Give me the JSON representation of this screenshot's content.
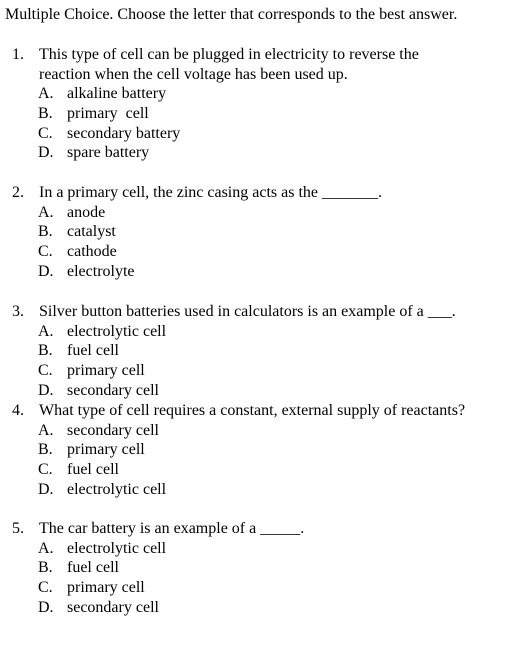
{
  "instructions": "Multiple Choice.  Choose the letter that corresponds to the best answer.",
  "questions": [
    {
      "number": "1.",
      "lines": [
        "This type of cell can be plugged in electricity to reverse the",
        "reaction when the cell voltage has been used up."
      ],
      "options": [
        {
          "letter": "A.",
          "text": "alkaline battery"
        },
        {
          "letter": "B.",
          "text": "primary  cell"
        },
        {
          "letter": "C.",
          "text": "secondary battery"
        },
        {
          "letter": "D.",
          "text": "spare battery"
        }
      ]
    },
    {
      "number": "2.",
      "lines": [
        "In a primary cell, the zinc casing acts as the _______."
      ],
      "options": [
        {
          "letter": "A.",
          "text": "anode"
        },
        {
          "letter": "B.",
          "text": "catalyst"
        },
        {
          "letter": "C.",
          "text": "cathode"
        },
        {
          "letter": "D.",
          "text": "electrolyte"
        }
      ]
    },
    {
      "number": "3.",
      "lines": [
        "Silver button batteries used in calculators is an example of a ___."
      ],
      "options": [
        {
          "letter": "A.",
          "text": "electrolytic cell"
        },
        {
          "letter": "B.",
          "text": "fuel cell"
        },
        {
          "letter": "C.",
          "text": "primary cell"
        },
        {
          "letter": "D.",
          "text": "secondary cell"
        }
      ]
    },
    {
      "number": "4.",
      "lines": [
        "What type of cell requires a constant, external supply of reactants?"
      ],
      "options": [
        {
          "letter": "A.",
          "text": "secondary cell"
        },
        {
          "letter": "B.",
          "text": "primary cell"
        },
        {
          "letter": "C.",
          "text": "fuel cell"
        },
        {
          "letter": "D.",
          "text": "electrolytic cell"
        }
      ]
    },
    {
      "number": "5.",
      "lines": [
        "The car battery is an example of a _____."
      ],
      "options": [
        {
          "letter": "A.",
          "text": "electrolytic cell"
        },
        {
          "letter": "B.",
          "text": "fuel cell"
        },
        {
          "letter": "C.",
          "text": "primary cell"
        },
        {
          "letter": "D.",
          "text": "secondary cell"
        }
      ]
    }
  ]
}
